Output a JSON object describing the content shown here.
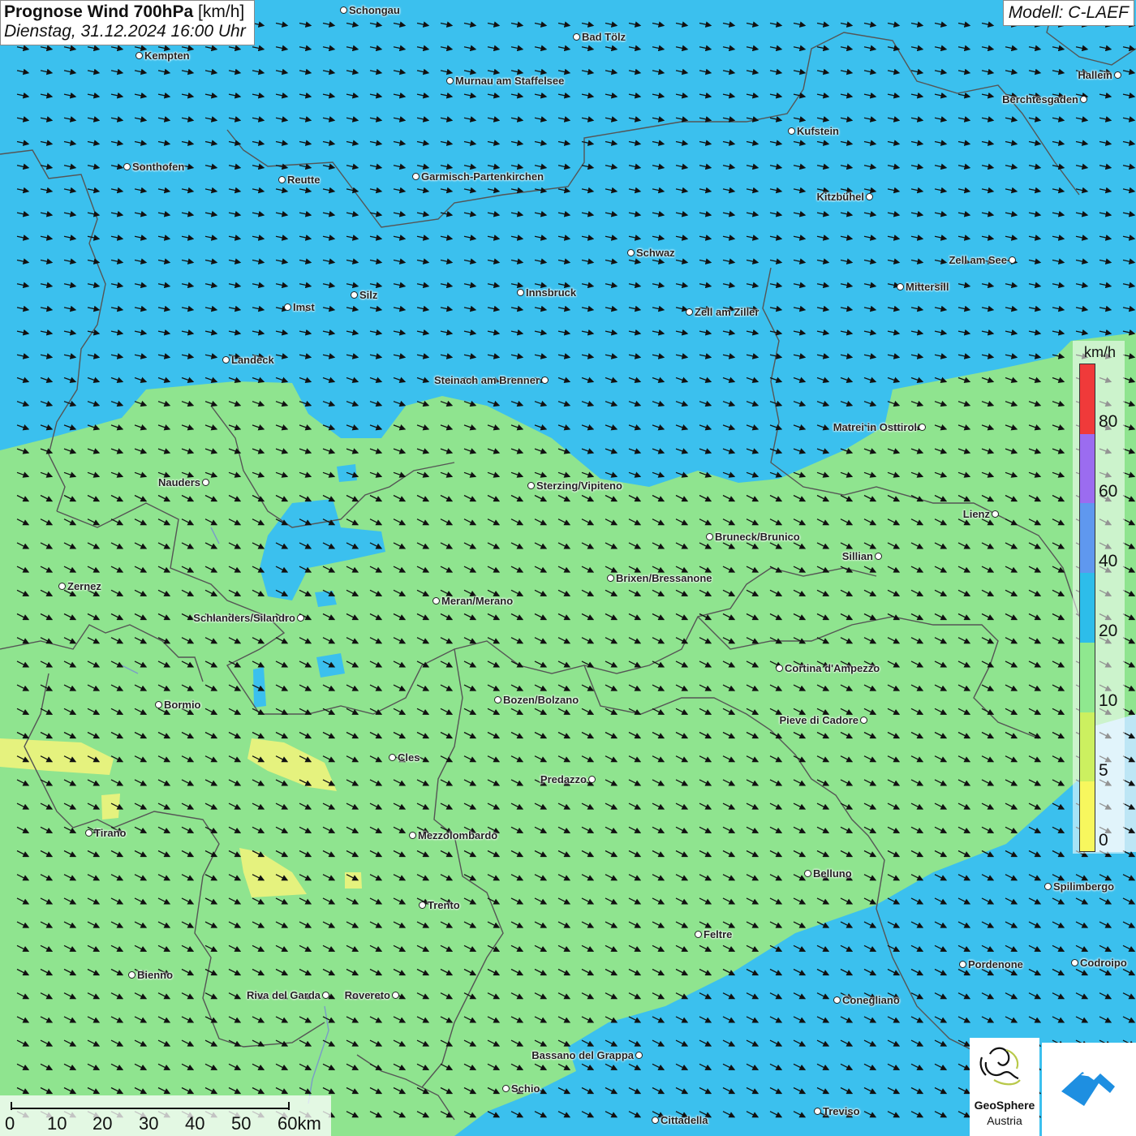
{
  "header": {
    "title": "Prognose Wind 700hPa",
    "unit": "[km/h]",
    "datetime": "Dienstag, 31.12.2024 16:00 Uhr",
    "model": "Modell: C-LAEF"
  },
  "legend": {
    "unit": "km/h",
    "ticks": [
      "80",
      "60",
      "40",
      "20",
      "10",
      "5",
      "0"
    ],
    "colors": [
      "#f03a3a",
      "#9b6cf0",
      "#5f98ef",
      "#2dbdea",
      "#8fe88f",
      "#ccf060",
      "#f7f75e"
    ]
  },
  "colors": {
    "ocean_wind": "#3bc0ee",
    "strong_wind": "#4cb5ee",
    "moderate_wind": "#8fe48f",
    "calm_wind": "#e5f27e",
    "border": "#555555"
  },
  "wind_direction": "east-southeast",
  "cities": [
    {
      "name": "Schongau",
      "label_side": "right"
    },
    {
      "name": "Bad Tölz",
      "label_side": "right"
    },
    {
      "name": "Kempten",
      "label_side": "right"
    },
    {
      "name": "Murnau am Staffelsee",
      "label_side": "right"
    },
    {
      "name": "Hallein",
      "label_side": "left"
    },
    {
      "name": "Berchtesgaden",
      "label_side": "left"
    },
    {
      "name": "Kufstein",
      "label_side": "right"
    },
    {
      "name": "Sonthofen",
      "label_side": "right"
    },
    {
      "name": "Reutte",
      "label_side": "right"
    },
    {
      "name": "Garmisch-Partenkirchen",
      "label_side": "right"
    },
    {
      "name": "Kitzbühel",
      "label_side": "left"
    },
    {
      "name": "Schwaz",
      "label_side": "right"
    },
    {
      "name": "Zell am See",
      "label_side": "left"
    },
    {
      "name": "Mittersill",
      "label_side": "right"
    },
    {
      "name": "Innsbruck",
      "label_side": "right"
    },
    {
      "name": "Silz",
      "label_side": "right"
    },
    {
      "name": "Imst",
      "label_side": "right"
    },
    {
      "name": "Zell am Ziller",
      "label_side": "right"
    },
    {
      "name": "Landeck",
      "label_side": "right"
    },
    {
      "name": "Steinach am Brenner",
      "label_side": "left"
    },
    {
      "name": "Matrei in Osttirol",
      "label_side": "left"
    },
    {
      "name": "Nauders",
      "label_side": "left"
    },
    {
      "name": "Sterzing/Vipiteno",
      "label_side": "right"
    },
    {
      "name": "Lienz",
      "label_side": "left"
    },
    {
      "name": "Bruneck/Brunico",
      "label_side": "right"
    },
    {
      "name": "Sillian",
      "label_side": "left"
    },
    {
      "name": "Zernez",
      "label_side": "right"
    },
    {
      "name": "Brixen/Bressanone",
      "label_side": "right"
    },
    {
      "name": "Meran/Merano",
      "label_side": "right"
    },
    {
      "name": "Schlanders/Silandro",
      "label_side": "left"
    },
    {
      "name": "Cortina d'Ampezzo",
      "label_side": "right"
    },
    {
      "name": "Bozen/Bolzano",
      "label_side": "right"
    },
    {
      "name": "Bormio",
      "label_side": "right"
    },
    {
      "name": "Pieve di Cadore",
      "label_side": "left"
    },
    {
      "name": "Cles",
      "label_side": "right"
    },
    {
      "name": "Predazzo",
      "label_side": "left"
    },
    {
      "name": "Tirano",
      "label_side": "right"
    },
    {
      "name": "Mezzolombardo",
      "label_side": "right"
    },
    {
      "name": "Belluno",
      "label_side": "right"
    },
    {
      "name": "Spilimbergo",
      "label_side": "right"
    },
    {
      "name": "Trento",
      "label_side": "right"
    },
    {
      "name": "Feltre",
      "label_side": "right"
    },
    {
      "name": "Pordenone",
      "label_side": "right"
    },
    {
      "name": "Codroipo",
      "label_side": "right"
    },
    {
      "name": "Bienno",
      "label_side": "right"
    },
    {
      "name": "Riva del Garda",
      "label_side": "left"
    },
    {
      "name": "Rovereto",
      "label_side": "left"
    },
    {
      "name": "Conegliano",
      "label_side": "right"
    },
    {
      "name": "Bassano del Grappa",
      "label_side": "left"
    },
    {
      "name": "Schio",
      "label_side": "right"
    },
    {
      "name": "Treviso",
      "label_side": "right"
    },
    {
      "name": "Cittadella",
      "label_side": "right"
    }
  ],
  "scalebar": {
    "labels": [
      "0",
      "10",
      "20",
      "30",
      "40",
      "50",
      "60km"
    ]
  },
  "logos": {
    "geosphere_line1": "GeoSphere",
    "geosphere_line2": "Austria"
  }
}
